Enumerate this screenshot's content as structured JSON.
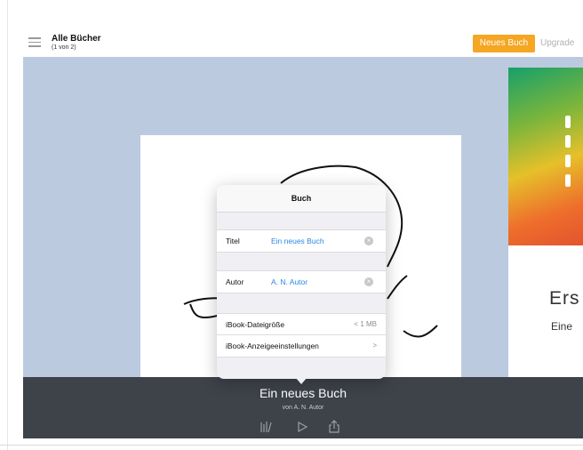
{
  "header": {
    "title": "Alle Bücher",
    "subtitle": "(1 von 2)",
    "new_book_label": "Neues Buch",
    "upgrade_label": "Upgrade"
  },
  "book": {
    "title": "Ein neues Buch",
    "author_line": "von A. N. Autor"
  },
  "cover": {
    "heading": "Ers",
    "sub": "Eine"
  },
  "popover": {
    "title": "Buch",
    "fields": {
      "title_label": "Titel",
      "title_value": "Ein neues Buch",
      "author_label": "Autor",
      "author_value": "A. N. Autor"
    },
    "size_label": "iBook-Dateigröße",
    "size_value": "< 1 MB",
    "display_settings_label": "iBook-Anzeigeeinstellungen"
  },
  "bottombar_icons": [
    "library-icon",
    "play-icon",
    "share-icon"
  ],
  "colors": {
    "accent": "#f5a623",
    "link": "#2b86e1",
    "canvas": "#bccadf",
    "bottombar": "#3e4249"
  }
}
